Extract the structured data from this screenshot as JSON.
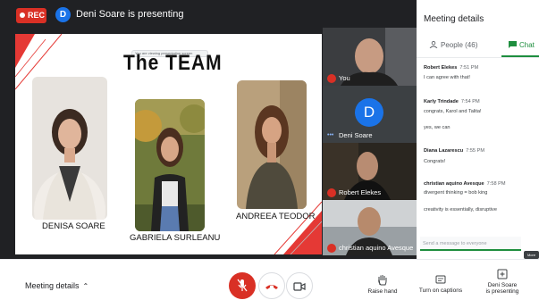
{
  "topbar": {
    "rec_label": "REC",
    "presenter_initial": "D",
    "presenting_text": "Deni Soare is presenting"
  },
  "slide": {
    "title": "The TEAM",
    "zoom_notice": "You are viewing presentation screen",
    "members": [
      {
        "name": "DENISA SOARE"
      },
      {
        "name": "GABRIELA SURLEANU"
      },
      {
        "name": "ANDREEA TEODOR"
      }
    ]
  },
  "tiles": [
    {
      "name": "You",
      "muted": true
    },
    {
      "name": "Deni Soare",
      "initial": "D",
      "speaking": true
    },
    {
      "name": "Robert Elekes",
      "muted": true
    },
    {
      "name": "christian aquino Avesque",
      "muted": true
    }
  ],
  "panel": {
    "title": "Meeting details",
    "tabs": {
      "people": "People (46)",
      "chat": "Chat"
    },
    "messages": [
      {
        "author": "Robert Elekes",
        "time": "7:51 PM",
        "lines": [
          "I can agree with that!"
        ]
      },
      {
        "author": "Karly Trindade",
        "time": "7:54 PM",
        "lines": [
          "congrats, Karol and Talita!",
          "yes, we can"
        ]
      },
      {
        "author": "Diana Lazarescu",
        "time": "7:55 PM",
        "lines": [
          "Congrats!"
        ]
      },
      {
        "author": "christian aquino Avesque",
        "time": "7:58 PM",
        "lines": [
          "divergent thinking = bob king",
          "creativity is essentially, disruptive"
        ]
      }
    ],
    "input_placeholder": "Send a message to everyone",
    "send_label": "More options"
  },
  "bottombar": {
    "meeting_details": "Meeting details",
    "raise_hand": "Raise hand",
    "captions": "Turn on captions",
    "presenting_line1": "Deni Soare",
    "presenting_line2": "is presenting"
  },
  "colors": {
    "rec": "#d93025",
    "accent_blue": "#1a73e8",
    "chat_green": "#1e8e3e",
    "dark_bg": "#202124"
  }
}
